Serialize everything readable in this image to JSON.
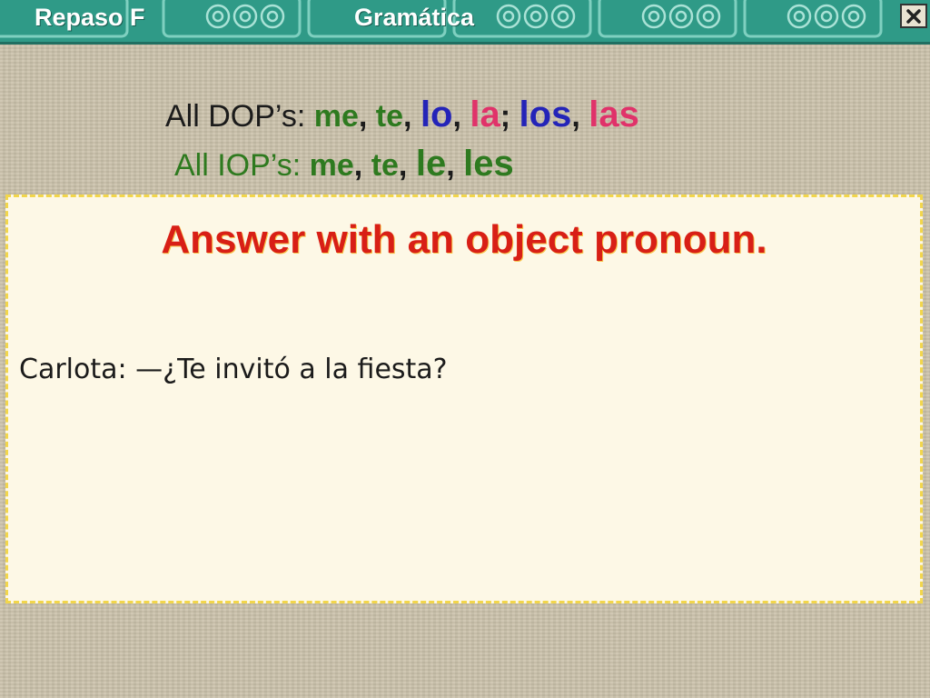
{
  "header": {
    "left_title": "Repaso F",
    "right_title": "Gramática",
    "close_icon": "close-icon"
  },
  "dop": {
    "label": "All DOP’s:",
    "me": "me",
    "te": "te",
    "lo": "lo",
    "la": "la",
    "los": "los",
    "las": "las"
  },
  "iop": {
    "label": "All IOP’s:",
    "me": "me",
    "te": "te",
    "le": "le",
    "les": "les"
  },
  "card": {
    "title": "Answer with an object pronoun.",
    "question": "Carlota: —¿Te invitó a la fiesta?"
  },
  "colors": {
    "header": "#2f9a87",
    "green": "#2e7a1f",
    "blue": "#2424b8",
    "pink": "#e0326a",
    "title_red": "#d81f16",
    "card_bg": "#fdf8e6",
    "card_border": "#f2d64b"
  }
}
